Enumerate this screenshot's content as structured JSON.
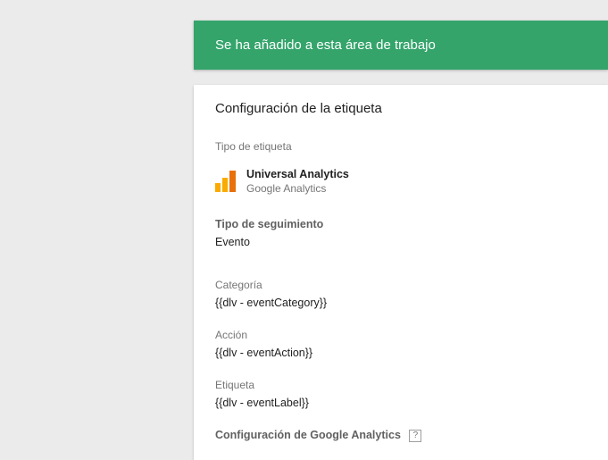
{
  "notification": {
    "text": "Se ha añadido a esta área de trabajo",
    "color": "#34a46b"
  },
  "tag_config": {
    "title": "Configuración de la etiqueta",
    "tag_type_label": "Tipo de etiqueta",
    "tag_type": {
      "name": "Universal Analytics",
      "vendor": "Google Analytics",
      "icon": "google-analytics-icon"
    },
    "tracking_type_label": "Tipo de seguimiento",
    "tracking_type_value": "Evento",
    "category_label": "Categoría",
    "category_value": "{{dlv - eventCategory}}",
    "action_label": "Acción",
    "action_value": "{{dlv - eventAction}}",
    "label_label": "Etiqueta",
    "label_value": "{{dlv - eventLabel}}",
    "ga_settings_label": "Configuración de Google Analytics",
    "help_icon_text": "?"
  }
}
